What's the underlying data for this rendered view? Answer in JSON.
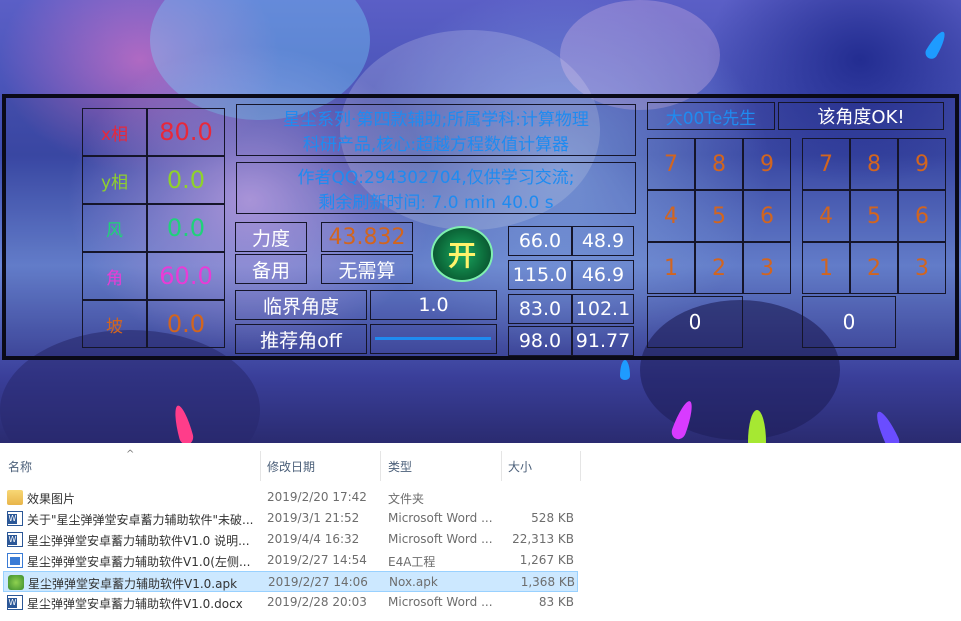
{
  "game": {
    "x_label": "x相",
    "x_value": "80.0",
    "y_label": "y相",
    "y_value": "0.0",
    "wind_label": "风",
    "wind_value": "0.0",
    "angle_label": "角",
    "angle_value": "60.0",
    "slope_label": "坡",
    "slope_value": "0.0",
    "info_line1": "星尘系列·第四款辅助;所属学科:计算物理",
    "info_line2": "科研产品,核心:超越方程数值计算器",
    "info_line3": "作者QQ:294302704,仅供学习交流;",
    "info_line4": "剩余刷新时间: 7.0 min 40.0 s",
    "force_label": "力度",
    "force_value": "43.832",
    "backup_label": "备用",
    "backup_value": "无需算",
    "open_button": "开",
    "critical_label": "临界角度",
    "critical_value": "1.0",
    "recommend_label": "推荐角off",
    "table": [
      [
        "66.0",
        "48.9"
      ],
      [
        "115.0",
        "46.9"
      ],
      [
        "83.0",
        "102.1"
      ],
      [
        "98.0",
        "91.77"
      ]
    ],
    "author_tag": "大00Te先生",
    "status": "该角度OK!",
    "keypad_left": [
      "7",
      "8",
      "9",
      "4",
      "5",
      "6",
      "1",
      "2",
      "3"
    ],
    "keypad_left_zero": "0",
    "keypad_right": [
      "7",
      "8",
      "9",
      "4",
      "5",
      "6",
      "1",
      "2",
      "3"
    ],
    "keypad_right_zero": "0",
    "colors": {
      "x": "#e8283a",
      "y": "#8fd12b",
      "wind": "#1fd27a",
      "angle": "#e83cd6",
      "slope": "#d2651f",
      "info": "#1f8bf0",
      "force": "#d2651f",
      "keypad": "#d2651f"
    }
  },
  "explorer": {
    "columns": {
      "name": "名称",
      "modified": "修改日期",
      "type": "类型",
      "size": "大小"
    },
    "files": [
      {
        "icon": "folder-icon",
        "name": "效果图片",
        "modified": "2019/2/20 17:42",
        "type": "文件夹",
        "size": ""
      },
      {
        "icon": "word-icon",
        "name": "关于\"星尘弹弹堂安卓蓄力辅助软件\"未破...",
        "modified": "2019/3/1 21:52",
        "type": "Microsoft Word ...",
        "size": "528 KB"
      },
      {
        "icon": "word-icon",
        "name": "星尘弹弹堂安卓蓄力辅助软件V1.0 说明...",
        "modified": "2019/4/4 16:32",
        "type": "Microsoft Word ...",
        "size": "22,313 KB"
      },
      {
        "icon": "e4a-icon",
        "name": "星尘弹弹堂安卓蓄力辅助软件V1.0(左侧...",
        "modified": "2019/2/27 14:54",
        "type": "E4A工程",
        "size": "1,267 KB"
      },
      {
        "icon": "apk-icon",
        "name": "星尘弹弹堂安卓蓄力辅助软件V1.0.apk",
        "modified": "2019/2/27 14:06",
        "type": "Nox.apk",
        "size": "1,368 KB"
      },
      {
        "icon": "word-icon",
        "name": "星尘弹弹堂安卓蓄力辅助软件V1.0.docx",
        "modified": "2019/2/28 20:03",
        "type": "Microsoft Word ...",
        "size": "83 KB"
      }
    ]
  }
}
